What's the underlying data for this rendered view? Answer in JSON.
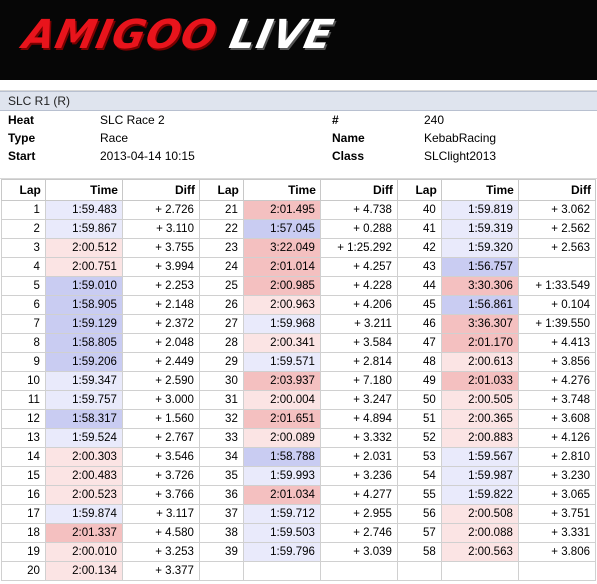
{
  "logo": {
    "word1": "AMIGOO",
    "word2": "LIVE"
  },
  "section_title": "SLC R1 (R)",
  "info": {
    "rows": [
      {
        "k1": "Heat",
        "v1": "SLC Race 2",
        "k2": "#",
        "v2": "240"
      },
      {
        "k1": "Type",
        "v1": "Race",
        "k2": "Name",
        "v2": "KebabRacing"
      },
      {
        "k1": "Start",
        "v1": "2013-04-14 10:15",
        "k2": "Class",
        "v2": "SLClight2013"
      }
    ]
  },
  "headers": [
    "Lap",
    "Time",
    "Diff",
    "Lap",
    "Time",
    "Diff",
    "Lap",
    "Time",
    "Diff"
  ],
  "colors": {
    "best": "#c9ccf2",
    "good": "#e9eafb",
    "bad": "#f4c0c0",
    "slight": "#fbe4e4",
    "none": "#ffffff"
  },
  "laps": [
    {
      "lap": "1",
      "time": "1:59.483",
      "diff": "+ 2.726",
      "shade": "good"
    },
    {
      "lap": "2",
      "time": "1:59.867",
      "diff": "+ 3.110",
      "shade": "good"
    },
    {
      "lap": "3",
      "time": "2:00.512",
      "diff": "+ 3.755",
      "shade": "slight"
    },
    {
      "lap": "4",
      "time": "2:00.751",
      "diff": "+ 3.994",
      "shade": "slight"
    },
    {
      "lap": "5",
      "time": "1:59.010",
      "diff": "+ 2.253",
      "shade": "best"
    },
    {
      "lap": "6",
      "time": "1:58.905",
      "diff": "+ 2.148",
      "shade": "best"
    },
    {
      "lap": "7",
      "time": "1:59.129",
      "diff": "+ 2.372",
      "shade": "best"
    },
    {
      "lap": "8",
      "time": "1:58.805",
      "diff": "+ 2.048",
      "shade": "best"
    },
    {
      "lap": "9",
      "time": "1:59.206",
      "diff": "+ 2.449",
      "shade": "best"
    },
    {
      "lap": "10",
      "time": "1:59.347",
      "diff": "+ 2.590",
      "shade": "good"
    },
    {
      "lap": "11",
      "time": "1:59.757",
      "diff": "+ 3.000",
      "shade": "good"
    },
    {
      "lap": "12",
      "time": "1:58.317",
      "diff": "+ 1.560",
      "shade": "best"
    },
    {
      "lap": "13",
      "time": "1:59.524",
      "diff": "+ 2.767",
      "shade": "good"
    },
    {
      "lap": "14",
      "time": "2:00.303",
      "diff": "+ 3.546",
      "shade": "slight"
    },
    {
      "lap": "15",
      "time": "2:00.483",
      "diff": "+ 3.726",
      "shade": "slight"
    },
    {
      "lap": "16",
      "time": "2:00.523",
      "diff": "+ 3.766",
      "shade": "slight"
    },
    {
      "lap": "17",
      "time": "1:59.874",
      "diff": "+ 3.117",
      "shade": "good"
    },
    {
      "lap": "18",
      "time": "2:01.337",
      "diff": "+ 4.580",
      "shade": "bad"
    },
    {
      "lap": "19",
      "time": "2:00.010",
      "diff": "+ 3.253",
      "shade": "slight"
    },
    {
      "lap": "20",
      "time": "2:00.134",
      "diff": "+ 3.377",
      "shade": "slight"
    },
    {
      "lap": "21",
      "time": "2:01.495",
      "diff": "+ 4.738",
      "shade": "bad"
    },
    {
      "lap": "22",
      "time": "1:57.045",
      "diff": "+ 0.288",
      "shade": "best"
    },
    {
      "lap": "23",
      "time": "3:22.049",
      "diff": "+ 1:25.292",
      "shade": "bad"
    },
    {
      "lap": "24",
      "time": "2:01.014",
      "diff": "+ 4.257",
      "shade": "bad"
    },
    {
      "lap": "25",
      "time": "2:00.985",
      "diff": "+ 4.228",
      "shade": "bad"
    },
    {
      "lap": "26",
      "time": "2:00.963",
      "diff": "+ 4.206",
      "shade": "slight"
    },
    {
      "lap": "27",
      "time": "1:59.968",
      "diff": "+ 3.211",
      "shade": "good"
    },
    {
      "lap": "28",
      "time": "2:00.341",
      "diff": "+ 3.584",
      "shade": "slight"
    },
    {
      "lap": "29",
      "time": "1:59.571",
      "diff": "+ 2.814",
      "shade": "good"
    },
    {
      "lap": "30",
      "time": "2:03.937",
      "diff": "+ 7.180",
      "shade": "bad"
    },
    {
      "lap": "31",
      "time": "2:00.004",
      "diff": "+ 3.247",
      "shade": "slight"
    },
    {
      "lap": "32",
      "time": "2:01.651",
      "diff": "+ 4.894",
      "shade": "bad"
    },
    {
      "lap": "33",
      "time": "2:00.089",
      "diff": "+ 3.332",
      "shade": "slight"
    },
    {
      "lap": "34",
      "time": "1:58.788",
      "diff": "+ 2.031",
      "shade": "best"
    },
    {
      "lap": "35",
      "time": "1:59.993",
      "diff": "+ 3.236",
      "shade": "good"
    },
    {
      "lap": "36",
      "time": "2:01.034",
      "diff": "+ 4.277",
      "shade": "bad"
    },
    {
      "lap": "37",
      "time": "1:59.712",
      "diff": "+ 2.955",
      "shade": "good"
    },
    {
      "lap": "38",
      "time": "1:59.503",
      "diff": "+ 2.746",
      "shade": "good"
    },
    {
      "lap": "39",
      "time": "1:59.796",
      "diff": "+ 3.039",
      "shade": "good"
    },
    {
      "lap": "40",
      "time": "1:59.819",
      "diff": "+ 3.062",
      "shade": "good"
    },
    {
      "lap": "41",
      "time": "1:59.319",
      "diff": "+ 2.562",
      "shade": "good"
    },
    {
      "lap": "42",
      "time": "1:59.320",
      "diff": "+ 2.563",
      "shade": "good"
    },
    {
      "lap": "43",
      "time": "1:56.757",
      "diff": "",
      "shade": "best"
    },
    {
      "lap": "44",
      "time": "3:30.306",
      "diff": "+ 1:33.549",
      "shade": "bad"
    },
    {
      "lap": "45",
      "time": "1:56.861",
      "diff": "+ 0.104",
      "shade": "best"
    },
    {
      "lap": "46",
      "time": "3:36.307",
      "diff": "+ 1:39.550",
      "shade": "bad"
    },
    {
      "lap": "47",
      "time": "2:01.170",
      "diff": "+ 4.413",
      "shade": "bad"
    },
    {
      "lap": "48",
      "time": "2:00.613",
      "diff": "+ 3.856",
      "shade": "slight"
    },
    {
      "lap": "49",
      "time": "2:01.033",
      "diff": "+ 4.276",
      "shade": "bad"
    },
    {
      "lap": "50",
      "time": "2:00.505",
      "diff": "+ 3.748",
      "shade": "slight"
    },
    {
      "lap": "51",
      "time": "2:00.365",
      "diff": "+ 3.608",
      "shade": "slight"
    },
    {
      "lap": "52",
      "time": "2:00.883",
      "diff": "+ 4.126",
      "shade": "slight"
    },
    {
      "lap": "53",
      "time": "1:59.567",
      "diff": "+ 2.810",
      "shade": "good"
    },
    {
      "lap": "54",
      "time": "1:59.987",
      "diff": "+ 3.230",
      "shade": "good"
    },
    {
      "lap": "55",
      "time": "1:59.822",
      "diff": "+ 3.065",
      "shade": "good"
    },
    {
      "lap": "56",
      "time": "2:00.508",
      "diff": "+ 3.751",
      "shade": "slight"
    },
    {
      "lap": "57",
      "time": "2:00.088",
      "diff": "+ 3.331",
      "shade": "slight"
    },
    {
      "lap": "58",
      "time": "2:00.563",
      "diff": "+ 3.806",
      "shade": "slight"
    }
  ]
}
